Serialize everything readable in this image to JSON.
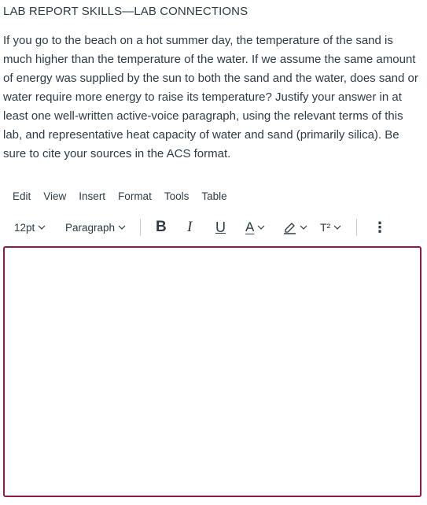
{
  "question": {
    "title": "LAB REPORT SKILLS—LAB CONNECTIONS",
    "body": "If you go to the beach on a hot summer day, the temperature of the sand is much higher than the temperature of the water. If we assume the same amount of energy was supplied by the sun to both the sand and the water, does sand or water require more energy to raise its temperature? Justify your answer in at least one well-written active-voice paragraph, using the relevant terms of this lab, and representative heat capacity of water and sand (primarily silica). Be sure to cite your sources in the ACS format."
  },
  "menubar": {
    "items": [
      "Edit",
      "View",
      "Insert",
      "Format",
      "Tools",
      "Table"
    ]
  },
  "toolbar": {
    "font_size": "12pt",
    "block_format": "Paragraph",
    "bold": "B",
    "italic": "I",
    "underline": "U",
    "text_color": "A",
    "superscript": "T²",
    "more": "⋮",
    "icons": {
      "highlight": "pencil-highlight-icon",
      "chevron": "chevron-down-icon"
    }
  },
  "editor": {
    "content": "",
    "border_color": "#8c1b4b"
  },
  "colors": {
    "text": "#2d3b45",
    "separator": "#c7cdd1",
    "focus_border": "#8c1b4b"
  }
}
